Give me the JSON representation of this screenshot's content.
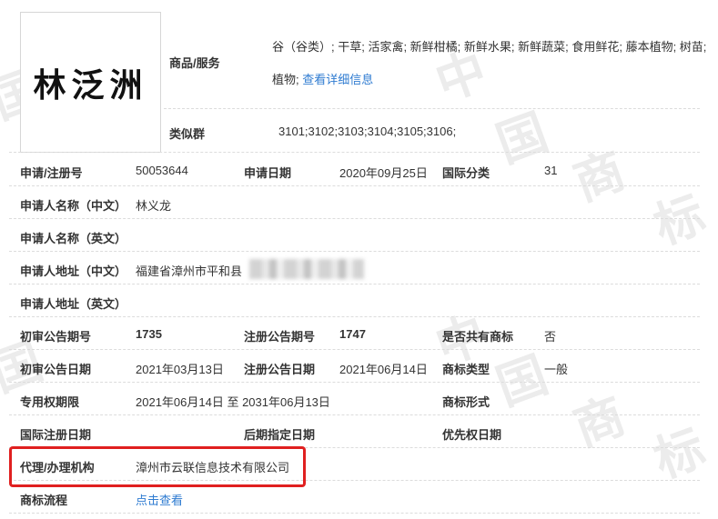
{
  "trademark": {
    "name_image_text": "林泛洲",
    "goods_services_label": "商品/服务",
    "goods_services_line1": "谷（谷类）; 干草; 活家禽; 新鲜柑橘; 新鲜水果; 新鲜蔬菜; 食用鲜花; 藤本植物; 树苗;",
    "goods_services_line2": "植物;",
    "view_details_link": "查看详细信息",
    "similar_group_label": "类似群",
    "similar_group_value": "3101;3102;3103;3104;3105;3106;"
  },
  "details": {
    "reg_no_label": "申请/注册号",
    "reg_no_value": "50053644",
    "apply_date_label": "申请日期",
    "apply_date_value": "2020年09月25日",
    "intl_class_label": "国际分类",
    "intl_class_value": "31",
    "applicant_cn_label": "申请人名称（中文）",
    "applicant_cn_value": "林义龙",
    "applicant_en_label": "申请人名称（英文）",
    "address_cn_label": "申请人地址（中文）",
    "address_cn_value": "福建省漳州市平和县",
    "address_en_label": "申请人地址（英文）",
    "prelim_issue_label": "初审公告期号",
    "prelim_issue_value": "1735",
    "reg_issue_label": "注册公告期号",
    "reg_issue_value": "1747",
    "shared_label": "是否共有商标",
    "shared_value": "否",
    "prelim_date_label": "初审公告日期",
    "prelim_date_value": "2021年03月13日",
    "reg_date_label": "注册公告日期",
    "reg_date_value": "2021年06月14日",
    "tm_type_label": "商标类型",
    "tm_type_value": "一般",
    "exclusive_label": "专用权期限",
    "exclusive_value": "2021年06月14日 至 2031年06月13日",
    "tm_form_label": "商标形式",
    "intl_reg_date_label": "国际注册日期",
    "later_designation_label": "后期指定日期",
    "priority_date_label": "优先权日期",
    "agent_label": "代理/办理机构",
    "agent_value": "漳州市云联信息技术有限公司",
    "process_label": "商标流程",
    "process_link": "点击查看"
  },
  "watermark": [
    "中",
    "国",
    "商",
    "标"
  ],
  "colors": {
    "link": "#2e7bd1",
    "highlight_box": "#e02020"
  }
}
